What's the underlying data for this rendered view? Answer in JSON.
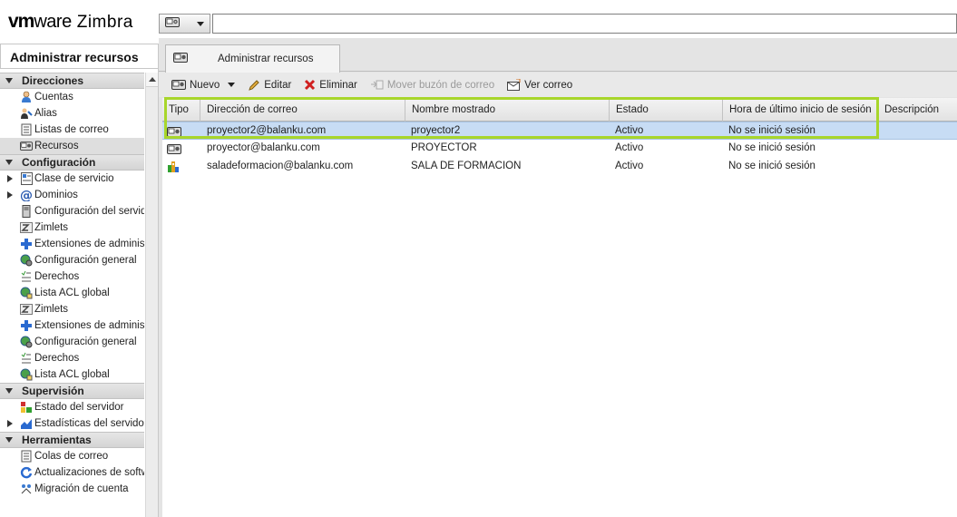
{
  "brand": {
    "vm": "vm",
    "ware": "ware",
    "product": "Zimbra"
  },
  "search": {
    "type_icon": "resource-icon",
    "value": "",
    "placeholder": ""
  },
  "leftnav": {
    "title": "Administrar recursos",
    "sections": [
      {
        "label": "Direcciones",
        "items": [
          {
            "label": "Cuentas",
            "icon": "account-icon"
          },
          {
            "label": "Alias",
            "icon": "alias-icon"
          },
          {
            "label": "Listas de correo",
            "icon": "mailing-list-icon"
          },
          {
            "label": "Recursos",
            "icon": "resource-icon",
            "selected": true
          }
        ]
      },
      {
        "label": "Configuración",
        "items": [
          {
            "label": "Clase de servicio",
            "icon": "cos-icon",
            "expandable": true
          },
          {
            "label": "Dominios",
            "icon": "domain-icon",
            "expandable": true
          },
          {
            "label": "Configuración del servidor",
            "icon": "server-icon"
          },
          {
            "label": "Zimlets",
            "icon": "zimlet-icon"
          },
          {
            "label": "Extensiones de administración",
            "icon": "extension-icon"
          },
          {
            "label": "Configuración general",
            "icon": "global-settings-icon"
          },
          {
            "label": "Derechos",
            "icon": "rights-icon"
          },
          {
            "label": "Lista ACL global",
            "icon": "global-acl-icon"
          },
          {
            "label": "Zimlets",
            "icon": "zimlet-icon"
          },
          {
            "label": "Extensiones de administración",
            "icon": "extension-icon"
          },
          {
            "label": "Configuración general",
            "icon": "global-settings-icon"
          },
          {
            "label": "Derechos",
            "icon": "rights-icon"
          },
          {
            "label": "Lista ACL global",
            "icon": "global-acl-icon"
          }
        ]
      },
      {
        "label": "Supervisión",
        "items": [
          {
            "label": "Estado del servidor",
            "icon": "server-status-icon"
          },
          {
            "label": "Estadísticas del servidor",
            "icon": "server-stats-icon",
            "expandable": true
          }
        ]
      },
      {
        "label": "Herramientas",
        "items": [
          {
            "label": "Colas de correo",
            "icon": "mail-queue-icon"
          },
          {
            "label": "Actualizaciones de software",
            "icon": "update-icon"
          },
          {
            "label": "Migración de cuenta",
            "icon": "migration-icon"
          }
        ]
      }
    ]
  },
  "tab": {
    "label": "Administrar recursos",
    "icon": "resource-icon"
  },
  "toolbar": {
    "new_label": "Nuevo",
    "edit_label": "Editar",
    "delete_label": "Eliminar",
    "move_mailbox_label": "Mover buzón de correo",
    "view_mail_label": "Ver correo"
  },
  "table": {
    "columns": [
      "Tipo",
      "Dirección de correo",
      "Nombre mostrado",
      "Estado",
      "Hora de último inicio de sesión",
      "Descripción"
    ],
    "rows": [
      {
        "type_icon": "resource-icon",
        "email": "proyector2@balanku.com",
        "display_name": "proyector2",
        "status": "Activo",
        "last_login": "No se inició sesión",
        "description": "",
        "selected": true
      },
      {
        "type_icon": "resource-icon",
        "email": "proyector@balanku.com",
        "display_name": "PROYECTOR",
        "status": "Activo",
        "last_login": "No se inició sesión",
        "description": ""
      },
      {
        "type_icon": "location-icon",
        "email": "saladeformacion@balanku.com",
        "display_name": "SALA DE FORMACION",
        "status": "Activo",
        "last_login": "No se inició sesión",
        "description": ""
      }
    ]
  },
  "colors": {
    "highlight": "#a8d62b",
    "selected_row": "#c7dcf4"
  }
}
